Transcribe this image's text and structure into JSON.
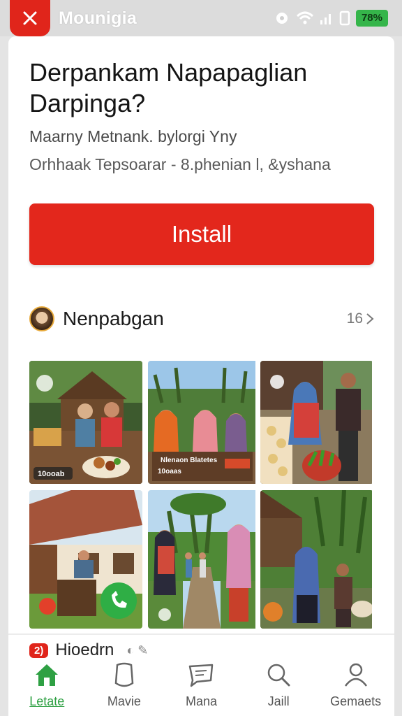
{
  "status_bar": {
    "app_title": "Mounigia",
    "battery": "78%"
  },
  "card": {
    "headline": "Derpankam Napapaglian Darpinga?",
    "subtitle_1": "Maarny Metnank. bylorgi Yny",
    "subtitle_2": "Orhhaak Tepsoarar - 8.phenian l, &yshana",
    "install_label": "Install"
  },
  "section": {
    "title": "Nenpabgan",
    "count": "16"
  },
  "grid": {
    "tiles": [
      {
        "caption": "10ooab"
      },
      {
        "caption_1": "Nlenaon Blatetes",
        "caption_2": "10oaas"
      },
      {
        "caption": ""
      },
      {
        "caption": ""
      },
      {
        "caption": ""
      },
      {
        "caption": ""
      }
    ]
  },
  "promo": {
    "badge": "2)",
    "text": "Hioedrn"
  },
  "nav": {
    "items": [
      {
        "label": "Letate",
        "icon": "home-icon",
        "active": true
      },
      {
        "label": "Mavie",
        "icon": "bookmark-icon",
        "active": false
      },
      {
        "label": "Mana",
        "icon": "chat-icon",
        "active": false
      },
      {
        "label": "Jaill",
        "icon": "search-icon",
        "active": false
      },
      {
        "label": "Gemaets",
        "icon": "profile-icon",
        "active": false
      }
    ]
  },
  "colors": {
    "accent_red": "#e3271c",
    "active_green": "#2ea043"
  }
}
